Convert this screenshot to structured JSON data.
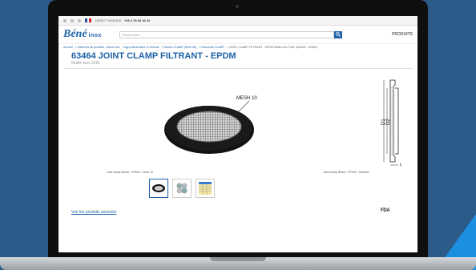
{
  "toolbar": {
    "direct_label": "DIRECT AGENCE :",
    "phone": "+33 4 78 66 46 22"
  },
  "header": {
    "logo_main": "Béné",
    "logo_sub": "inox",
    "search_placeholder": "Rechercher...",
    "products_label": "PRODUITS"
  },
  "breadcrumb": {
    "items": [
      "Accueil",
      "Gammes de produits - Béné Inox",
      "Agro-alimentaire et vinicole",
      "Norme CLAMP (Série 63)",
      "Raccords CLAMP"
    ],
    "current": "JOINT CLAMP FILTRANT - EPDM Maille inox 316L (Modèle : 63464)"
  },
  "product": {
    "title": "63464 JOINT CLAMP FILTRANT - EPDM",
    "subtitle": "Maille inox 316L",
    "mesh_label": "MESH 10",
    "dim_d1": "D1",
    "dim_d2": "D2",
    "dim_l": "L",
    "caption_left": "Joint clamp filtrant - EPDM - mesh 10",
    "caption_right": "Joint clamp filtrant - EPDM - Schéma",
    "associated_link": "Voir les produits associés",
    "certification": "FDA"
  },
  "colors": {
    "brand": "#1f63a8",
    "background": "#2c5b8a",
    "accent": "#1d8fe0"
  }
}
